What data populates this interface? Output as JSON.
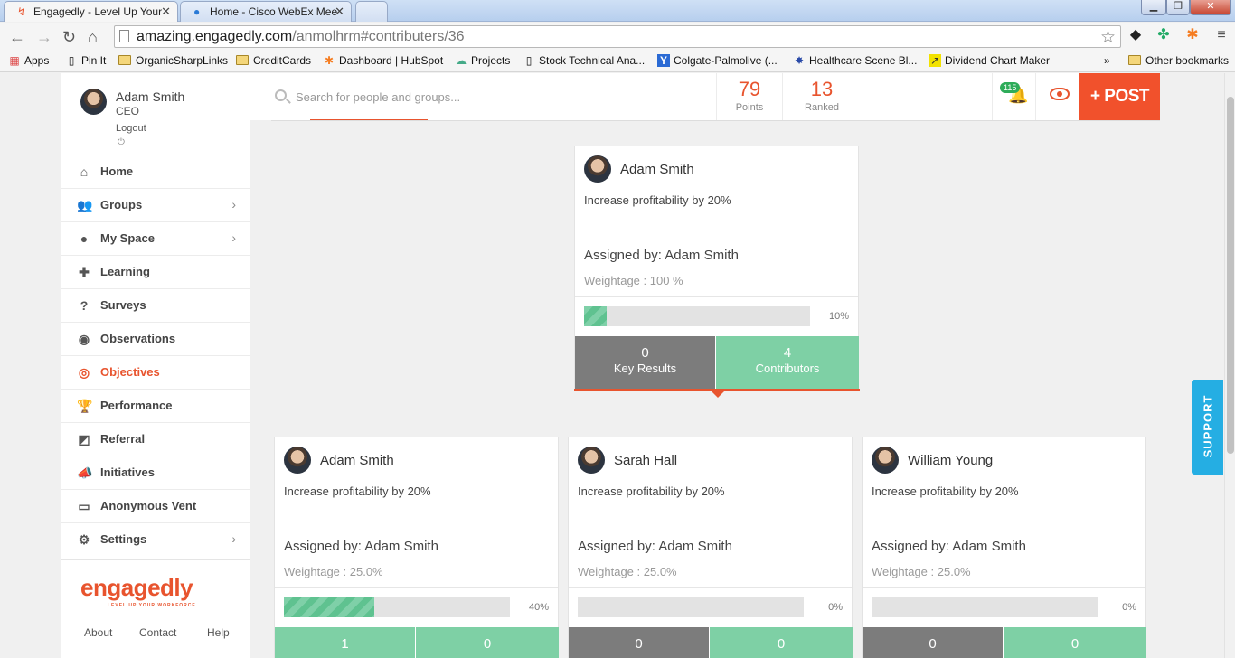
{
  "browser": {
    "tabs": [
      {
        "title": "Engagedly - Level Up Your",
        "icon": "engagedly-favicon"
      },
      {
        "title": "Home - Cisco WebEx Mee",
        "icon": "globe-favicon"
      }
    ],
    "url_host": "amazing.engagedly.com",
    "url_path": "/anmolhrm#contributers/36",
    "bookmarks": [
      "Apps",
      "Pin It",
      "OrganicSharpLinks",
      "CreditCards",
      "Dashboard | HubSpot",
      "Projects",
      "Stock Technical Ana...",
      "Colgate-Palmolive (...",
      "Healthcare Scene Bl...",
      "Dividend Chart Maker"
    ],
    "overflow": "»",
    "other_bookmarks": "Other bookmarks"
  },
  "profile": {
    "name": "Adam Smith",
    "role": "CEO",
    "logout": "Logout",
    "power_icon": "⏻"
  },
  "nav": [
    {
      "label": "Home",
      "icon": "home-icon",
      "glyph": "⌂",
      "chevron": ""
    },
    {
      "label": "Groups",
      "icon": "groups-icon",
      "glyph": "👥",
      "chevron": "›"
    },
    {
      "label": "My Space",
      "icon": "user-icon",
      "glyph": "●",
      "chevron": "›"
    },
    {
      "label": "Learning",
      "icon": "puzzle-icon",
      "glyph": "✚",
      "chevron": ""
    },
    {
      "label": "Surveys",
      "icon": "question-icon",
      "glyph": "?",
      "chevron": ""
    },
    {
      "label": "Observations",
      "icon": "eye-icon",
      "glyph": "◉",
      "chevron": ""
    },
    {
      "label": "Objectives",
      "icon": "target-icon",
      "glyph": "◎",
      "chevron": ""
    },
    {
      "label": "Performance",
      "icon": "trophy-icon",
      "glyph": "🏆",
      "chevron": ""
    },
    {
      "label": "Referral",
      "icon": "referral-icon",
      "glyph": "◩",
      "chevron": ""
    },
    {
      "label": "Initiatives",
      "icon": "megaphone-icon",
      "glyph": "📣",
      "chevron": ""
    },
    {
      "label": "Anonymous Vent",
      "icon": "inbox-icon",
      "glyph": "▭",
      "chevron": ""
    },
    {
      "label": "Settings",
      "icon": "gear-icon",
      "glyph": "⚙",
      "chevron": "›"
    }
  ],
  "active_nav": "Objectives",
  "logo": {
    "text": "engagedly",
    "tagline": "LEVEL UP YOUR WORKFORCE"
  },
  "footer": {
    "about": "About",
    "contact": "Contact",
    "help": "Help"
  },
  "header": {
    "search_placeholder": "Search for people and groups...",
    "points_value": "79",
    "points_label": "Points",
    "ranked_value": "13",
    "ranked_label": "Ranked",
    "notification_count": "115",
    "post_label": "+ POST"
  },
  "objective": {
    "owner": "Adam Smith",
    "title": "Increase profitability by 20%",
    "assigned": "Assigned by: Adam Smith",
    "weightage": "Weightage : 100 %",
    "progress": 0.1,
    "progress_label": "10%",
    "key_results_count": "0",
    "key_results_label": "Key Results",
    "contributors_count": "4",
    "contributors_label": "Contributors"
  },
  "contributors": [
    {
      "name": "Adam Smith",
      "title": "Increase profitability by 20%",
      "assigned": "Assigned by: Adam Smith",
      "weightage": "Weightage : 25.0%",
      "progress": 0.4,
      "progress_label": "40%",
      "left_count": "1",
      "right_count": "0",
      "left_color": "green"
    },
    {
      "name": "Sarah Hall",
      "title": "Increase profitability by 20%",
      "assigned": "Assigned by: Adam Smith",
      "weightage": "Weightage : 25.0%",
      "progress": 0,
      "progress_label": "0%",
      "left_count": "0",
      "right_count": "0",
      "left_color": "gray"
    },
    {
      "name": "William Young",
      "title": "Increase profitability by 20%",
      "assigned": "Assigned by: Adam Smith",
      "weightage": "Weightage : 25.0%",
      "progress": 0,
      "progress_label": "0%",
      "left_count": "0",
      "right_count": "0",
      "left_color": "gray"
    }
  ],
  "support_label": "SUPPORT",
  "colors": {
    "accent": "#e8542e",
    "green": "#7ed0a5",
    "gray": "#7c7c7c",
    "support": "#25aee3"
  }
}
